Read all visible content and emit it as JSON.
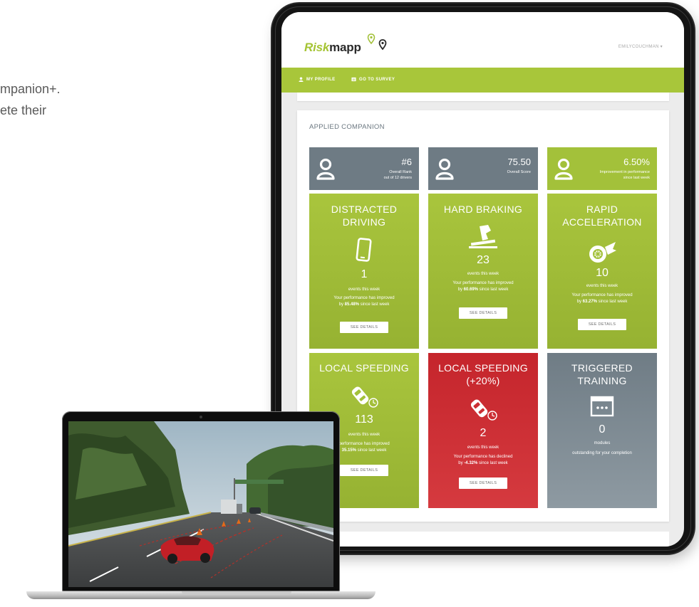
{
  "side_text": {
    "line1": "mpanion+.",
    "line2": "ete their"
  },
  "app": {
    "logo_part1": "Risk",
    "logo_part2": "mapp",
    "user_menu": "EMILYCOUCHMAN ▾"
  },
  "nav": {
    "profile": "MY PROFILE",
    "survey": "GO TO SURVEY"
  },
  "panel_title": "APPLIED COMPANION",
  "stats": [
    {
      "value": "#6",
      "line1": "Overall Rank",
      "line2": "out of 12 drivers",
      "color": "#6e7b84"
    },
    {
      "value": "75.50",
      "line1": "Overall Score",
      "line2": "",
      "color": "#6e7b84"
    },
    {
      "value": "6.50%",
      "line1": "Improvement in performance",
      "line2": "since last week",
      "color": "#a3c13a"
    }
  ],
  "cards": [
    {
      "title1": "DISTRACTED",
      "title2": "DRIVING",
      "icon": "phone-icon",
      "count": "1",
      "label": "events this week",
      "msg1": "Your performance has improved",
      "msg2_pre": "by ",
      "msg2_bold": "85.48%",
      "msg2_post": " since last week",
      "button": "SEE DETAILS"
    },
    {
      "title1": "HARD BRAKING",
      "title2": "",
      "icon": "brake-pedal-icon",
      "count": "23",
      "label": "events this week",
      "msg1": "Your performance has improved",
      "msg2_pre": "by ",
      "msg2_bold": "60.69%",
      "msg2_post": " since last week",
      "button": "SEE DETAILS"
    },
    {
      "title1": "RAPID",
      "title2": "ACCELERATION",
      "icon": "tire-icon",
      "count": "10",
      "label": "events this week",
      "msg1": "Your performance has improved",
      "msg2_pre": "by ",
      "msg2_bold": "63.27%",
      "msg2_post": " since last week",
      "button": "SEE DETAILS"
    },
    {
      "title1": "LOCAL SPEEDING",
      "title2": "",
      "icon": "speeding-car-icon",
      "count": "113",
      "label": "events this week",
      "msg1": "performance has improved",
      "msg2_pre": "",
      "msg2_bold": "35.15%",
      "msg2_post": " since last week",
      "button": "SEE DETAILS"
    },
    {
      "title1": "LOCAL SPEEDING",
      "title2": "(+20%)",
      "icon": "speeding-car-icon",
      "count": "2",
      "label": "events this week",
      "msg1": "Your performance has declined",
      "msg2_pre": "by ",
      "msg2_bold": "-4.32%",
      "msg2_post": " since last week",
      "button": "SEE DETAILS"
    },
    {
      "title1": "TRIGGERED",
      "title2": "TRAINING",
      "icon": "training-module-icon",
      "count": "0",
      "label": "modules",
      "msg1": "outstanding for your completion",
      "msg2_pre": "",
      "msg2_bold": "",
      "msg2_post": "",
      "button": ""
    }
  ],
  "colors": {
    "accent_green": "#a3c13a",
    "alert_red": "#cc2d33",
    "slate_gray": "#6e7b84"
  }
}
